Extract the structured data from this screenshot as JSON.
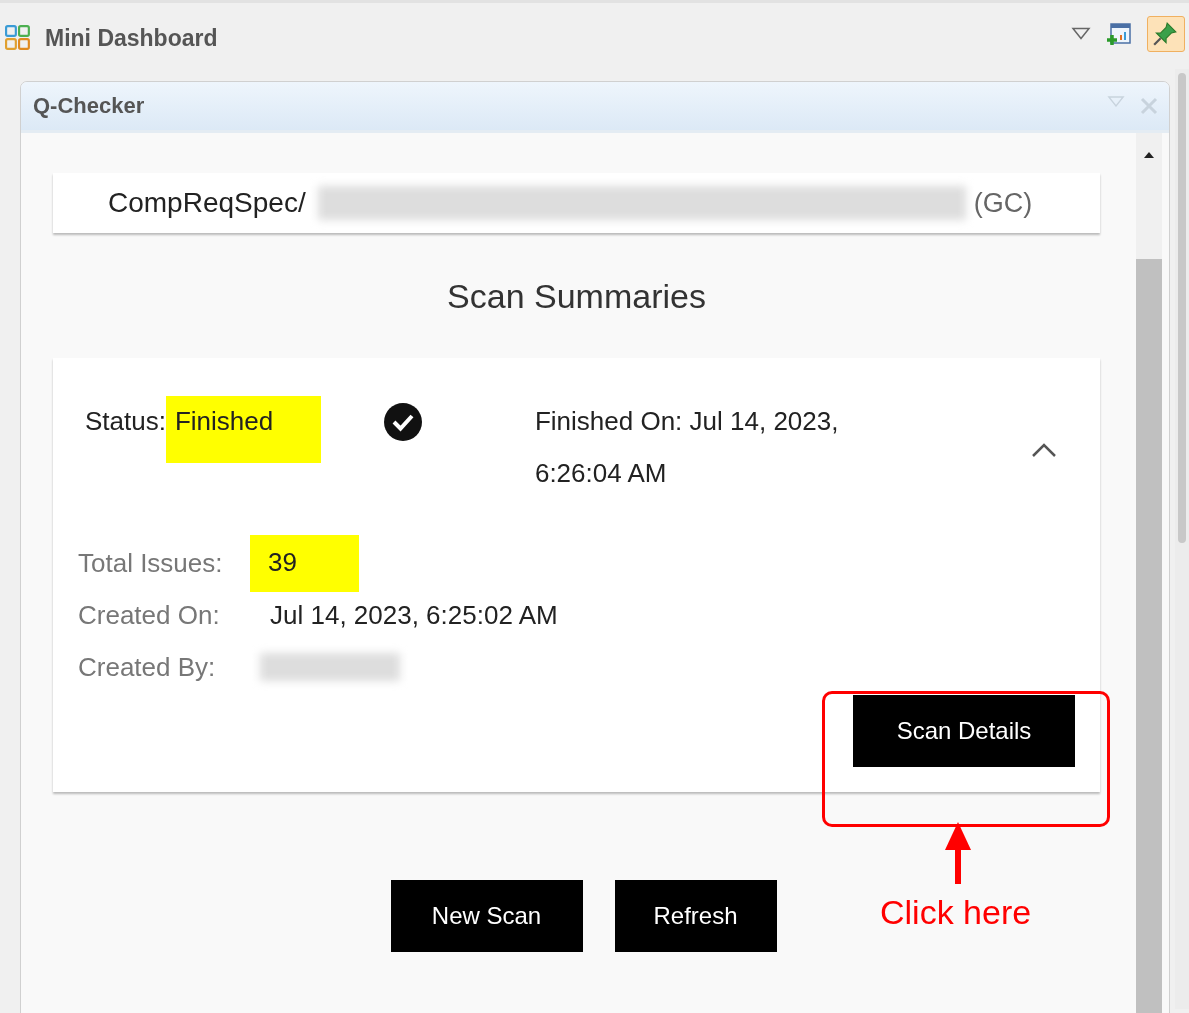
{
  "view": {
    "title": "Mini Dashboard"
  },
  "panel": {
    "title": "Q-Checker"
  },
  "breadcrumb": {
    "prefix": "CompReqSpec/",
    "suffix": "(GC)"
  },
  "heading": "Scan Summaries",
  "scan": {
    "status_label": "Status:",
    "status": "Finished",
    "status_highlighted": true,
    "finished": "Finished On: Jul 14, 2023, 6:26:04 AM",
    "expanded": true,
    "fields": [
      {
        "kind": "text",
        "label": "Total Issues:",
        "value": "39",
        "highlighted": true
      },
      {
        "kind": "text",
        "label": "Created On:",
        "value": "Jul 14, 2023, 6:25:02 AM",
        "highlighted": false
      },
      {
        "kind": "redacted",
        "label": "Created By:"
      }
    ],
    "details_button": "Scan Details"
  },
  "buttons": [
    "New Scan",
    "Refresh"
  ],
  "annotation": {
    "text": "Click here"
  }
}
